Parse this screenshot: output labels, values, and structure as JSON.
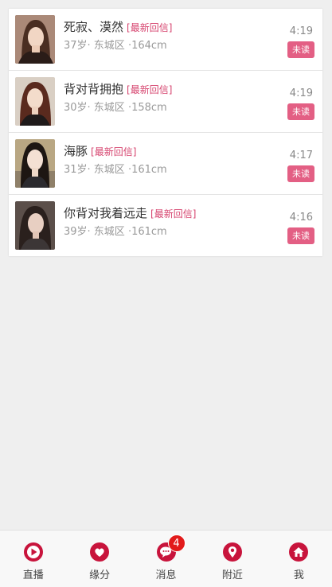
{
  "colors": {
    "accent": "#c8143c",
    "tag": "#d6436e",
    "badge_bg": "#e35f84",
    "notif": "#e21b1b",
    "background": "#efefef"
  },
  "messages": [
    {
      "name": "死寂、漠然",
      "tag": "[最新回信]",
      "info": "37岁· 东城区 ·164cm",
      "time": "4:19",
      "badge": "未读"
    },
    {
      "name": "背对背拥抱",
      "tag": "[最新回信]",
      "info": "30岁· 东城区 ·158cm",
      "time": "4:19",
      "badge": "未读"
    },
    {
      "name": "海豚",
      "tag": "[最新回信]",
      "info": "31岁· 东城区 ·161cm",
      "time": "4:17",
      "badge": "未读"
    },
    {
      "name": "你背对我着远走",
      "tag": "[最新回信]",
      "info": "39岁· 东城区 ·161cm",
      "time": "4:16",
      "badge": "未读"
    }
  ],
  "tabbar": {
    "tabs": [
      {
        "label": "直播",
        "icon": "live-play-icon"
      },
      {
        "label": "缘分",
        "icon": "heart-icon"
      },
      {
        "label": "消息",
        "icon": "message-bubble-icon",
        "badge": "4"
      },
      {
        "label": "附近",
        "icon": "location-pin-icon"
      },
      {
        "label": "我",
        "icon": "home-icon"
      }
    ]
  }
}
